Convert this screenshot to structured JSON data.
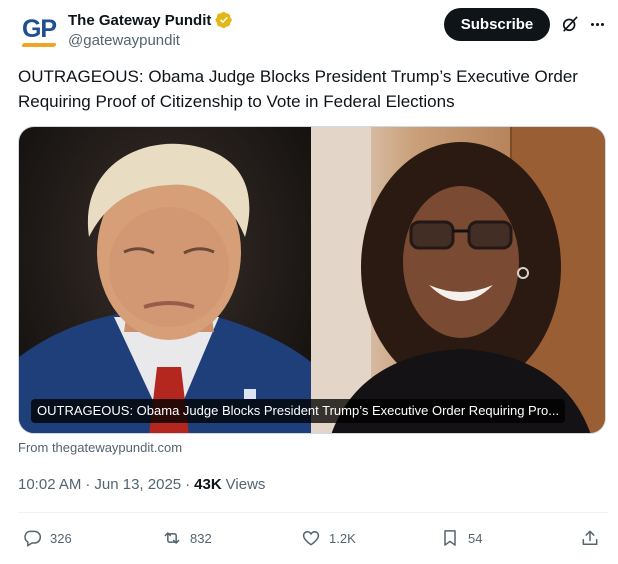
{
  "account": {
    "avatar_text": "GP",
    "display_name": "The Gateway Pundit",
    "handle": "@gatewaypundit",
    "verified_badge_color": "#e2b719",
    "avatar_text_color": "#1d4f91",
    "avatar_accent_color": "#f0a526"
  },
  "header": {
    "subscribe_label": "Subscribe",
    "grok_icon": "grok-icon",
    "more_icon": "more-dots-icon"
  },
  "tweet": {
    "text": "OUTRAGEOUS: Obama Judge Blocks President Trump’s Executive Order Requiring Proof of Citizenship to Vote in Federal Elections"
  },
  "card": {
    "caption": "OUTRAGEOUS: Obama Judge Blocks President Trump’s Executive Order Requiring Pro...",
    "source": "From thegatewaypundit.com"
  },
  "meta": {
    "time": "10:02 AM",
    "separator": "·",
    "date": "Jun 13, 2025",
    "views_count": "43K",
    "views_label": "Views"
  },
  "actions": {
    "replies": "326",
    "reposts": "832",
    "likes": "1.2K",
    "bookmarks": "54"
  },
  "colors": {
    "text_primary": "#0f1419",
    "text_secondary": "#536471",
    "border": "#cfd9de"
  }
}
